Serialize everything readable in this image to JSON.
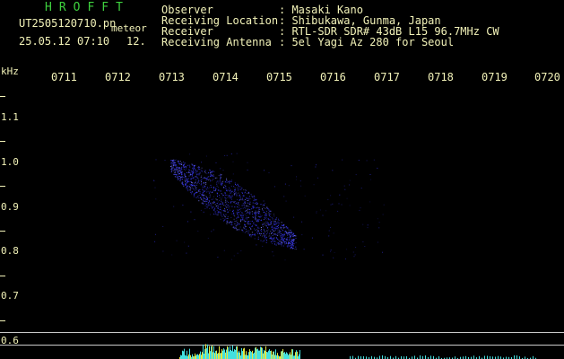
{
  "header": {
    "brand": "HROFFT",
    "filename": "UT2505120710.pn",
    "file_type": "meteor",
    "datetime": "25.05.12 07:10",
    "count": "12."
  },
  "info": [
    {
      "label": "Observer",
      "value": ": Masaki Kano"
    },
    {
      "label": "Receiving Location",
      "value": ": Shibukawa, Gunma, Japan"
    },
    {
      "label": "Receiver",
      "value": ": RTL-SDR SDR# 43dB L15 96.7MHz CW"
    },
    {
      "label": "Receiving Antenna",
      "value": ": 5el Yagi Az 280 for Seoul"
    }
  ],
  "axis": {
    "y_unit": "kHz",
    "x_ticks": [
      "0711",
      "0712",
      "0713",
      "0714",
      "0715",
      "0716",
      "0717",
      "0718",
      "0719",
      "0720"
    ],
    "y_ticks": [
      "1.1",
      "1.0",
      "0.9",
      "0.8",
      "0.7",
      "0.6"
    ]
  },
  "colors": {
    "label": "#f2f2b8",
    "brand": "#3ed13e",
    "echo": "#3a3aff",
    "spectrum": "#43e0e0"
  }
}
